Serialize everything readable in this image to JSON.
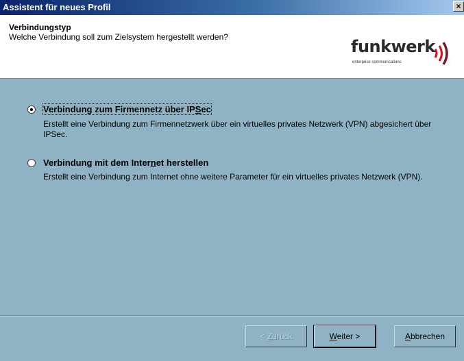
{
  "window": {
    "title": "Assistent für neues Profil",
    "close_symbol": "×"
  },
  "header": {
    "title": "Verbindungstyp",
    "subtitle": "Welche Verbindung soll zum Zielsystem hergestellt werden?",
    "logo": {
      "wordmark": "funkwerk",
      "tagline": "enterprise communications"
    }
  },
  "options": [
    {
      "label_pre": "Verbindung zum Firmennetz über IP",
      "label_mnemonic": "S",
      "label_post": "ec",
      "description": "Erstellt eine Verbindung zum Firmennetzwerk über ein virtuelles privates Netzwerk (VPN) abgesichert über IPSec.",
      "selected": true
    },
    {
      "label_pre": "Verbindung mit dem Inter",
      "label_mnemonic": "n",
      "label_post": "et herstellen",
      "description": "Erstellt eine Verbindung zum Internet ohne weitere Parameter für ein virtuelles privates Netzwerk (VPN).",
      "selected": false
    }
  ],
  "buttons": {
    "back": {
      "pre": "< ",
      "mnemonic": "Z",
      "post": "urück"
    },
    "next": {
      "pre": "",
      "mnemonic": "W",
      "post": "eiter >"
    },
    "cancel": {
      "pre": "",
      "mnemonic": "A",
      "post": "bbrechen"
    }
  }
}
